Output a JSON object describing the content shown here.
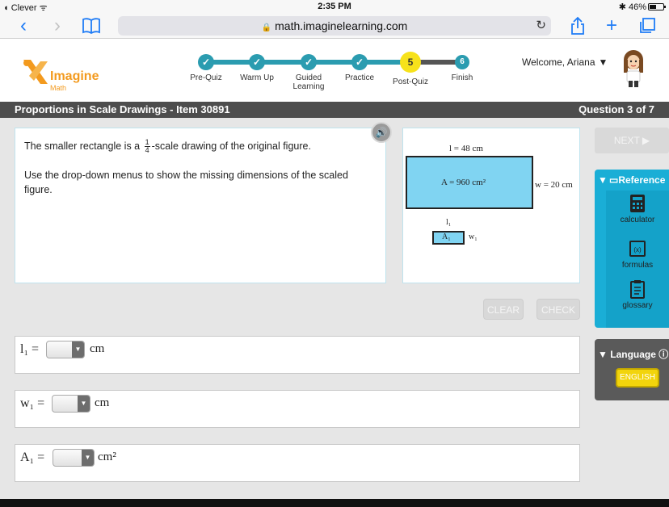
{
  "status": {
    "carrier": "Clever",
    "time": "2:35 PM",
    "battery": "46%"
  },
  "browser": {
    "url": "math.imaginelearning.com"
  },
  "logo": {
    "name": "Imagine",
    "sub": "Math"
  },
  "steps": [
    {
      "label": "Pre-Quiz",
      "state": "done"
    },
    {
      "label": "Warm Up",
      "state": "done"
    },
    {
      "label": "Guided Learning",
      "state": "done"
    },
    {
      "label": "Practice",
      "state": "done"
    },
    {
      "label": "Post-Quiz",
      "state": "current",
      "number": "5"
    },
    {
      "label": "Finish",
      "state": "pending",
      "number": "6"
    }
  ],
  "welcome": "Welcome, Ariana",
  "title": "Proportions in Scale Drawings - Item 30891",
  "question_counter": "Question 3 of 7",
  "question": {
    "line1_before": "The smaller rectangle is a",
    "fraction_num": "1",
    "fraction_den": "4",
    "line1_after": "-scale drawing of the original figure.",
    "line2": "Use the drop-down menus to show the missing dimensions of the scaled figure."
  },
  "figure": {
    "length_label": "l = 48 cm",
    "area_label": "A = 960  cm²",
    "width_label": "w = 20  cm",
    "small_length": "l₁",
    "small_area": "A₁",
    "small_width": "w₁"
  },
  "buttons": {
    "clear": "CLEAR",
    "check": "CHECK",
    "next": "NEXT ▶"
  },
  "answers": [
    {
      "label": "l₁ =",
      "unit": "cm"
    },
    {
      "label": "w₁ =",
      "unit": "cm"
    },
    {
      "label": "A₁ =",
      "unit": "cm²"
    }
  ],
  "reference": {
    "title": "Reference",
    "items": [
      "calculator",
      "formulas",
      "glossary"
    ]
  },
  "language": {
    "title": "Language",
    "button": "ENGLISH"
  }
}
